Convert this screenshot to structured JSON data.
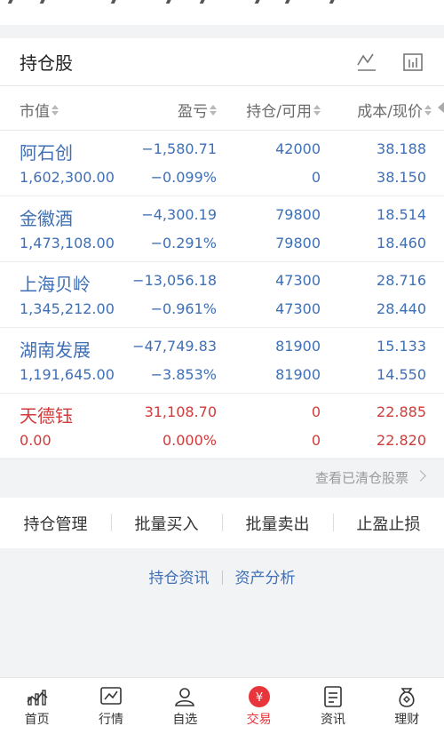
{
  "card": {
    "title": "持仓股"
  },
  "icons": {
    "trend": "line-chart-icon",
    "bars": "bar-chart-icon"
  },
  "columns": {
    "market_value": "市值",
    "profit_loss": "盈亏",
    "hold_avail": "持仓/可用",
    "cost_price": "成本/现价"
  },
  "holdings": [
    {
      "name": "阿石创",
      "market_value": "1,602,300.00",
      "pl": "−1,580.71",
      "pl_pct": "−0.099%",
      "hold": "42000",
      "avail": "0",
      "cost": "38.188",
      "price": "38.150",
      "color": "blue"
    },
    {
      "name": "金徽酒",
      "market_value": "1,473,108.00",
      "pl": "−4,300.19",
      "pl_pct": "−0.291%",
      "hold": "79800",
      "avail": "79800",
      "cost": "18.514",
      "price": "18.460",
      "color": "blue"
    },
    {
      "name": "上海贝岭",
      "market_value": "1,345,212.00",
      "pl": "−13,056.18",
      "pl_pct": "−0.961%",
      "hold": "47300",
      "avail": "47300",
      "cost": "28.716",
      "price": "28.440",
      "color": "blue"
    },
    {
      "name": "湖南发展",
      "market_value": "1,191,645.00",
      "pl": "−47,749.83",
      "pl_pct": "−3.853%",
      "hold": "81900",
      "avail": "81900",
      "cost": "15.133",
      "price": "14.550",
      "color": "blue"
    },
    {
      "name": "天德钰",
      "market_value": "0.00",
      "pl": "31,108.70",
      "pl_pct": "0.000%",
      "hold": "0",
      "avail": "0",
      "cost": "22.885",
      "price": "22.820",
      "color": "red"
    }
  ],
  "view_cleared": "查看已清仓股票",
  "actions": [
    "持仓管理",
    "批量买入",
    "批量卖出",
    "止盈止损"
  ],
  "links": [
    "持仓资讯",
    "资产分析"
  ],
  "tabs": [
    {
      "label": "首页",
      "icon": "home-icon"
    },
    {
      "label": "行情",
      "icon": "market-icon"
    },
    {
      "label": "自选",
      "icon": "watchlist-icon"
    },
    {
      "label": "交易",
      "icon": "trade-icon"
    },
    {
      "label": "资讯",
      "icon": "news-icon"
    },
    {
      "label": "理财",
      "icon": "wealth-icon"
    }
  ],
  "colors": {
    "blue": "#3f6fb5",
    "red": "#d23a3a",
    "active": "#e8343b"
  }
}
